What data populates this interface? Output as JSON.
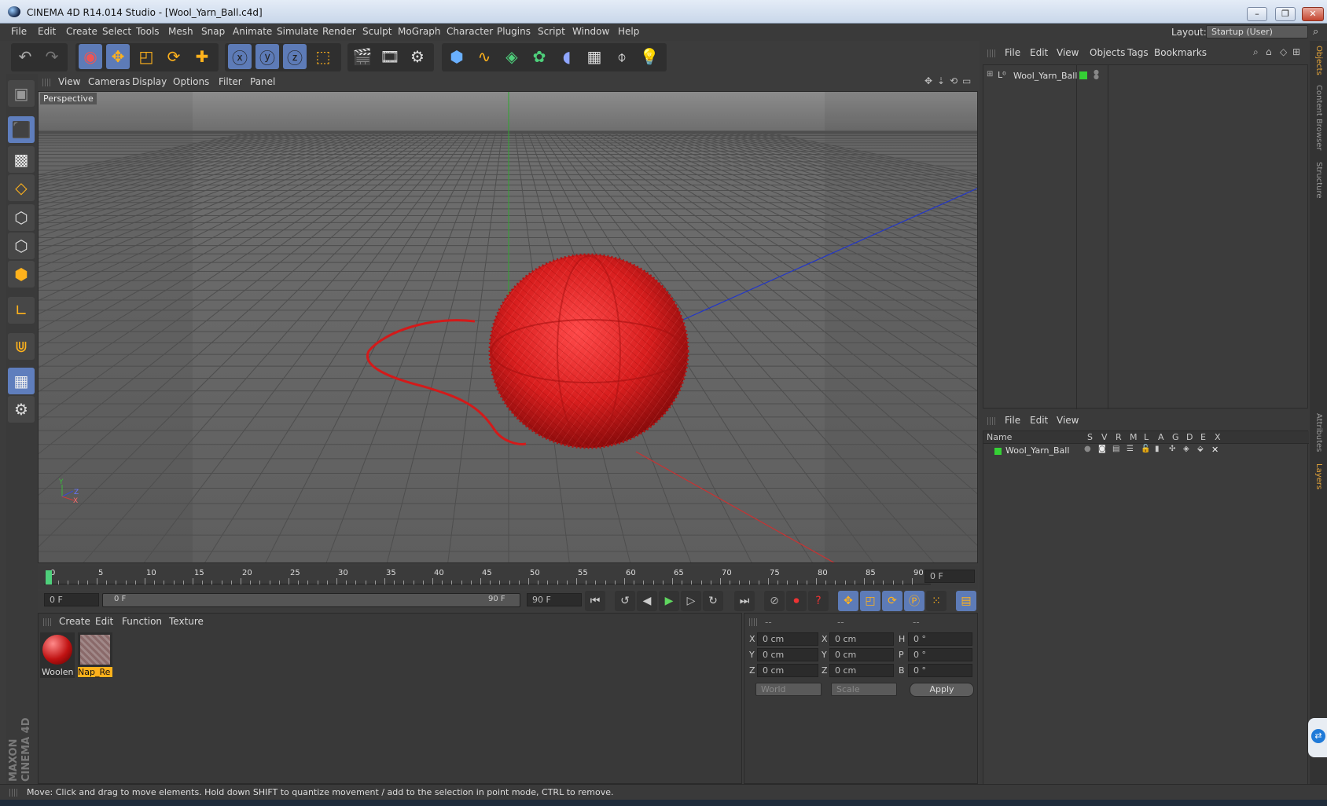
{
  "window": {
    "title": "CINEMA 4D R14.014 Studio - [Wool_Yarn_Ball.c4d]",
    "min": "–",
    "max": "❐",
    "close": "✕"
  },
  "menu": [
    "File",
    "Edit",
    "Create",
    "Select",
    "Tools",
    "Mesh",
    "Snap",
    "Animate",
    "Simulate",
    "Render",
    "Sculpt",
    "MoGraph",
    "Character",
    "Plugins",
    "Script",
    "Window",
    "Help"
  ],
  "layout": {
    "label": "Layout:",
    "value": "Startup (User)"
  },
  "viewport": {
    "menu": [
      "View",
      "Cameras",
      "Display",
      "Options",
      "Filter",
      "Panel"
    ],
    "label": "Perspective",
    "axis": {
      "y": "Y",
      "x": "X",
      "z": "Z"
    }
  },
  "timeline": {
    "ticks": [
      "0",
      "5",
      "10",
      "15",
      "20",
      "25",
      "30",
      "35",
      "40",
      "45",
      "50",
      "55",
      "60",
      "65",
      "70",
      "75",
      "80",
      "85",
      "90"
    ],
    "current": "0 F"
  },
  "transport": {
    "start": "0 F",
    "range_start": "0 F",
    "range_end": "90 F",
    "end": "90 F"
  },
  "materials": {
    "menu": [
      "Create",
      "Edit",
      "Function",
      "Texture"
    ],
    "items": [
      {
        "name": "Woolen"
      },
      {
        "name": "Nap_Re"
      }
    ]
  },
  "coords": {
    "headers": [
      "--",
      "--",
      "--"
    ],
    "rows": [
      {
        "a": "X",
        "av": "0 cm",
        "b": "X",
        "bv": "0 cm",
        "c": "H",
        "cv": "0 °"
      },
      {
        "a": "Y",
        "av": "0 cm",
        "b": "Y",
        "bv": "0 cm",
        "c": "P",
        "cv": "0 °"
      },
      {
        "a": "Z",
        "av": "0 cm",
        "b": "Z",
        "bv": "0 cm",
        "c": "B",
        "cv": "0 °"
      }
    ],
    "world": "World",
    "scale": "Scale",
    "apply": "Apply"
  },
  "objmgr": {
    "menu": [
      "File",
      "Edit",
      "View",
      "Objects",
      "Tags",
      "Bookmarks"
    ],
    "object": "Wool_Yarn_Ball"
  },
  "layermgr": {
    "menu": [
      "File",
      "Edit",
      "View"
    ],
    "columns": [
      "Name",
      "S",
      "V",
      "R",
      "M",
      "L",
      "A",
      "G",
      "D",
      "E",
      "X"
    ],
    "layer": "Wool_Yarn_Ball"
  },
  "vtabs": [
    "Objects",
    "Content Browser",
    "Structure",
    "Attributes",
    "Layers"
  ],
  "status": "Move: Click and drag to move elements. Hold down SHIFT to quantize movement / add to the selection in point mode, CTRL to remove.",
  "brand": {
    "line1": "MAXON",
    "line2": "CINEMA 4D"
  },
  "colors": {
    "accent": "#ffb21c",
    "selected": "#5d7bb7",
    "yarn": "#d81e1e"
  }
}
